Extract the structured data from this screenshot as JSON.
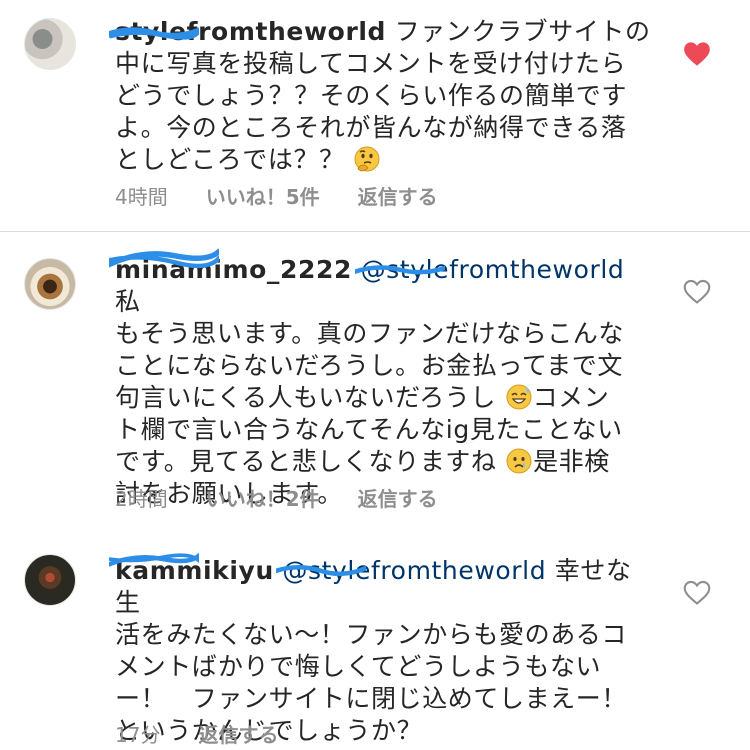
{
  "comments": [
    {
      "username": "stylefromtheworld",
      "mention": "",
      "text_lines": [
        " ファンクラブサイトの",
        "中に写真を投稿してコメントを受け付けたら",
        "どうでしょう？？そのくらい作るの簡単です",
        "よ。今のところそれが皆んなが納得できる落",
        "としどころでは？？"
      ],
      "emoji_end": "thinking-face-emoji",
      "time": "4時間",
      "likes": "いいね！5件",
      "reply": "返信する",
      "liked": true
    },
    {
      "username": "minamimo_2222",
      "mention": "@stylefromtheworld",
      "text_lines": [
        " 私",
        "もそう思います。真のファンだけならこんな",
        "ことにならないだろうし。お金払ってまで文",
        "句言いにくる人もいないだろうし",
        "コメン",
        "ト欄で言い合うなんてそんなig見たことない",
        "です。見てると悲しくなりますね",
        "是非検",
        "討をお願いします。"
      ],
      "time": "2時間",
      "likes": "いいね！2件",
      "reply": "返信する",
      "liked": false
    },
    {
      "username": "kammikiyu",
      "mention": "@stylefromtheworld",
      "text_lines": [
        " 幸せな生",
        "活をみたくない〜！ファンからも愛のあるコ",
        "メントばかりで悔しくてどうしようもない",
        "ー！　ファンサイトに閉じ込めてしまえー！",
        "というかんじでしょうか？"
      ],
      "time": "17分",
      "likes": "",
      "reply": "返信する",
      "liked": false
    }
  ],
  "colors": {
    "heart_liked": "#ed4956",
    "heart_outline": "#8e8e8e",
    "mention": "#003569",
    "meta": "#8e8e8e",
    "scribble": "#2d8ee8"
  }
}
